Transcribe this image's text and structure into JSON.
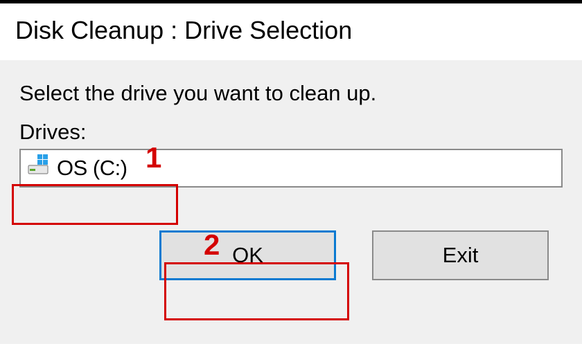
{
  "title": "Disk Cleanup : Drive Selection",
  "instruction": "Select the drive you want to clean up.",
  "drives_label": "Drives:",
  "drive": {
    "selected": "OS (C:)",
    "icon": "drive-os-icon"
  },
  "buttons": {
    "ok": "OK",
    "exit": "Exit"
  },
  "annotations": {
    "one": "1",
    "two": "2",
    "highlight_color": "#d40000"
  }
}
